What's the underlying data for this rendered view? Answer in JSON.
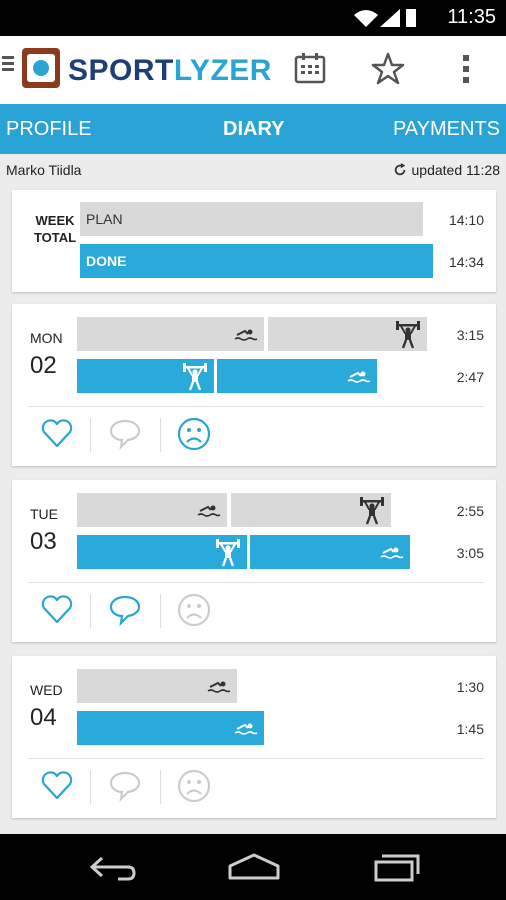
{
  "status": {
    "time": "11:35"
  },
  "app": {
    "logo_a": "SPORT",
    "logo_b": "LYZER"
  },
  "tabs": [
    "PROFILE",
    "DIARY",
    "PAYMENTS"
  ],
  "user": {
    "name": "Marko Tiidla",
    "updated": "updated 11:28"
  },
  "week": {
    "label_line1": "WEEK",
    "label_line2": "TOTAL",
    "plan_label": "PLAN",
    "done_label": "DONE",
    "plan_time": "14:10",
    "done_time": "14:34"
  },
  "days": [
    {
      "name": "MON",
      "num": "02",
      "plan_time": "3:15",
      "done_time": "2:47",
      "liked": true,
      "commented": false,
      "frown": true
    },
    {
      "name": "TUE",
      "num": "03",
      "plan_time": "2:55",
      "done_time": "3:05",
      "liked": true,
      "commented": true,
      "frown": false
    },
    {
      "name": "WED",
      "num": "04",
      "plan_time": "1:30",
      "done_time": "1:45",
      "liked": true,
      "commented": false,
      "frown": false
    }
  ],
  "icons": {
    "activity_swim": "swim-icon",
    "activity_gym": "weightlifting-icon",
    "like": "heart-icon",
    "comment": "comment-icon",
    "mood": "frown-face-icon",
    "refresh": "refresh-icon",
    "calendar": "calendar-icon",
    "star": "star-icon",
    "overflow": "overflow-menu-icon"
  },
  "colors": {
    "accent": "#29a3d5",
    "plan_bar": "#d9d9d9",
    "logo_dark": "#1e3f73",
    "logo_frame": "#8b3a1e"
  }
}
